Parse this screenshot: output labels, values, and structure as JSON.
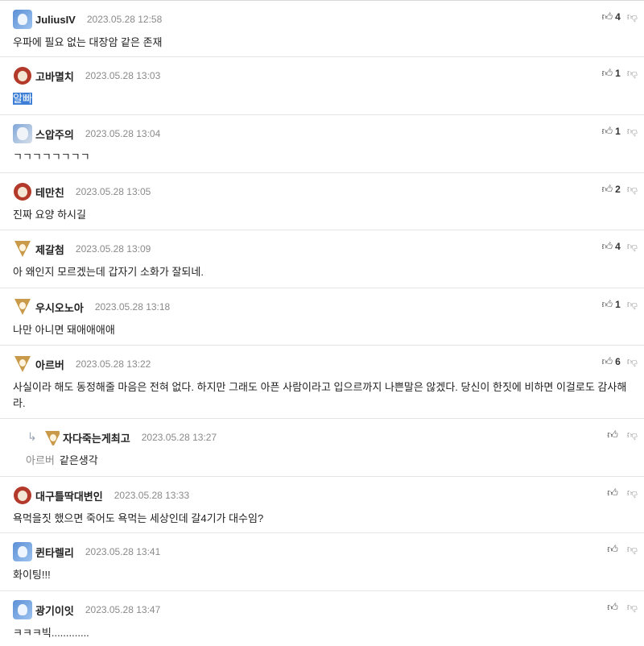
{
  "comments": [
    {
      "nick": "JuliusIV",
      "date": "2023.05.28 12:58",
      "body": "우파에 필요 없는 대장암 같은 존재",
      "up": "4",
      "avatar": "blue"
    },
    {
      "nick": "고바멸치",
      "date": "2023.05.28 13:03",
      "body": "알빠",
      "up": "1",
      "avatar": "red",
      "highlight": true
    },
    {
      "nick": "스압주의",
      "date": "2023.05.28 13:04",
      "body": "ㄱㄱㄱㄱㄱㄱㄱㄱ",
      "up": "1",
      "avatar": "mix"
    },
    {
      "nick": "테만친",
      "date": "2023.05.28 13:05",
      "body": "진짜 요양 하시길",
      "up": "2",
      "avatar": "red"
    },
    {
      "nick": "제갈첨",
      "date": "2023.05.28 13:09",
      "body": "아 왜인지 모르겠는데 갑자기 소화가 잘되네.",
      "up": "4",
      "avatar": "fox"
    },
    {
      "nick": "우시오노아",
      "date": "2023.05.28 13:18",
      "body": "나만 아니면 돼애애애애",
      "up": "1",
      "avatar": "fox"
    },
    {
      "nick": "아르버",
      "date": "2023.05.28 13:22",
      "body": "사실이라 해도 동정해줄 마음은 전혀 없다. 하지만 그래도 아픈 사람이라고 입으르까지 나쁜말은 않겠다. 당신이 한짓에 비하면 이걸로도 감사해라.",
      "up": "6",
      "avatar": "fox"
    },
    {
      "nick": "자다죽는게최고",
      "date": "2023.05.28 13:27",
      "reply_to": "아르버",
      "body": "같은생각",
      "up": "",
      "avatar": "fox"
    },
    {
      "nick": "대구틀딱대변인",
      "date": "2023.05.28 13:33",
      "body": "욕먹을짓 했으면 죽어도 욕먹는 세상인데 갈4기가 대수임?",
      "up": "",
      "avatar": "red"
    },
    {
      "nick": "퀸타렐리",
      "date": "2023.05.28 13:41",
      "body": "화이팅!!!",
      "up": "",
      "avatar": "blue"
    },
    {
      "nick": "광기이잇",
      "date": "2023.05.28 13:47",
      "body": "ㅋㅋㅋ빅.............",
      "up": "",
      "avatar": "blue"
    }
  ],
  "icons": {
    "upvote": "thumbs-up-icon",
    "downvote": "thumbs-down-icon",
    "reply": "reply-arrow-icon"
  },
  "colors": {
    "highlight": "#3d7fd6",
    "date": "#8a8a8a"
  }
}
